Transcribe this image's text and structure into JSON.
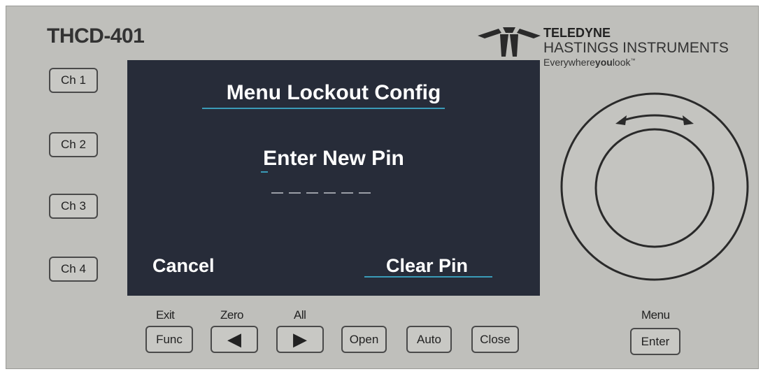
{
  "device": {
    "model": "THCD-401",
    "brand": {
      "name": "TELEDYNE",
      "division": "HASTINGS INSTRUMENTS",
      "tagline_a": "Everywhere",
      "tagline_b": "you",
      "tagline_c": "look",
      "tagline_tm": "™"
    }
  },
  "channels": [
    {
      "label": "Ch 1"
    },
    {
      "label": "Ch 2"
    },
    {
      "label": "Ch 3"
    },
    {
      "label": "Ch 4"
    }
  ],
  "screen": {
    "title": "Menu Lockout Config",
    "prompt": "Enter New Pin",
    "pin_placeholder": "______",
    "left_softkey": "Cancel",
    "right_softkey": "Clear Pin"
  },
  "bottom_buttons": {
    "func": {
      "label": "Func",
      "above": "Exit"
    },
    "left": {
      "label": "◀",
      "above": "Zero"
    },
    "right": {
      "label": "▶",
      "above": "All"
    },
    "open": {
      "label": "Open"
    },
    "auto": {
      "label": "Auto"
    },
    "close": {
      "label": "Close"
    },
    "enter": {
      "label": "Enter",
      "above": "Menu"
    }
  },
  "colors": {
    "panel": "#bfbfbb",
    "screen": "#272c39",
    "accent": "#3a9bb8",
    "text_on_screen": "#ffffff"
  },
  "icons": [
    "teledyne-logo-icon",
    "knob-rotate-arrow-icon",
    "left-arrow-icon",
    "right-arrow-icon"
  ]
}
